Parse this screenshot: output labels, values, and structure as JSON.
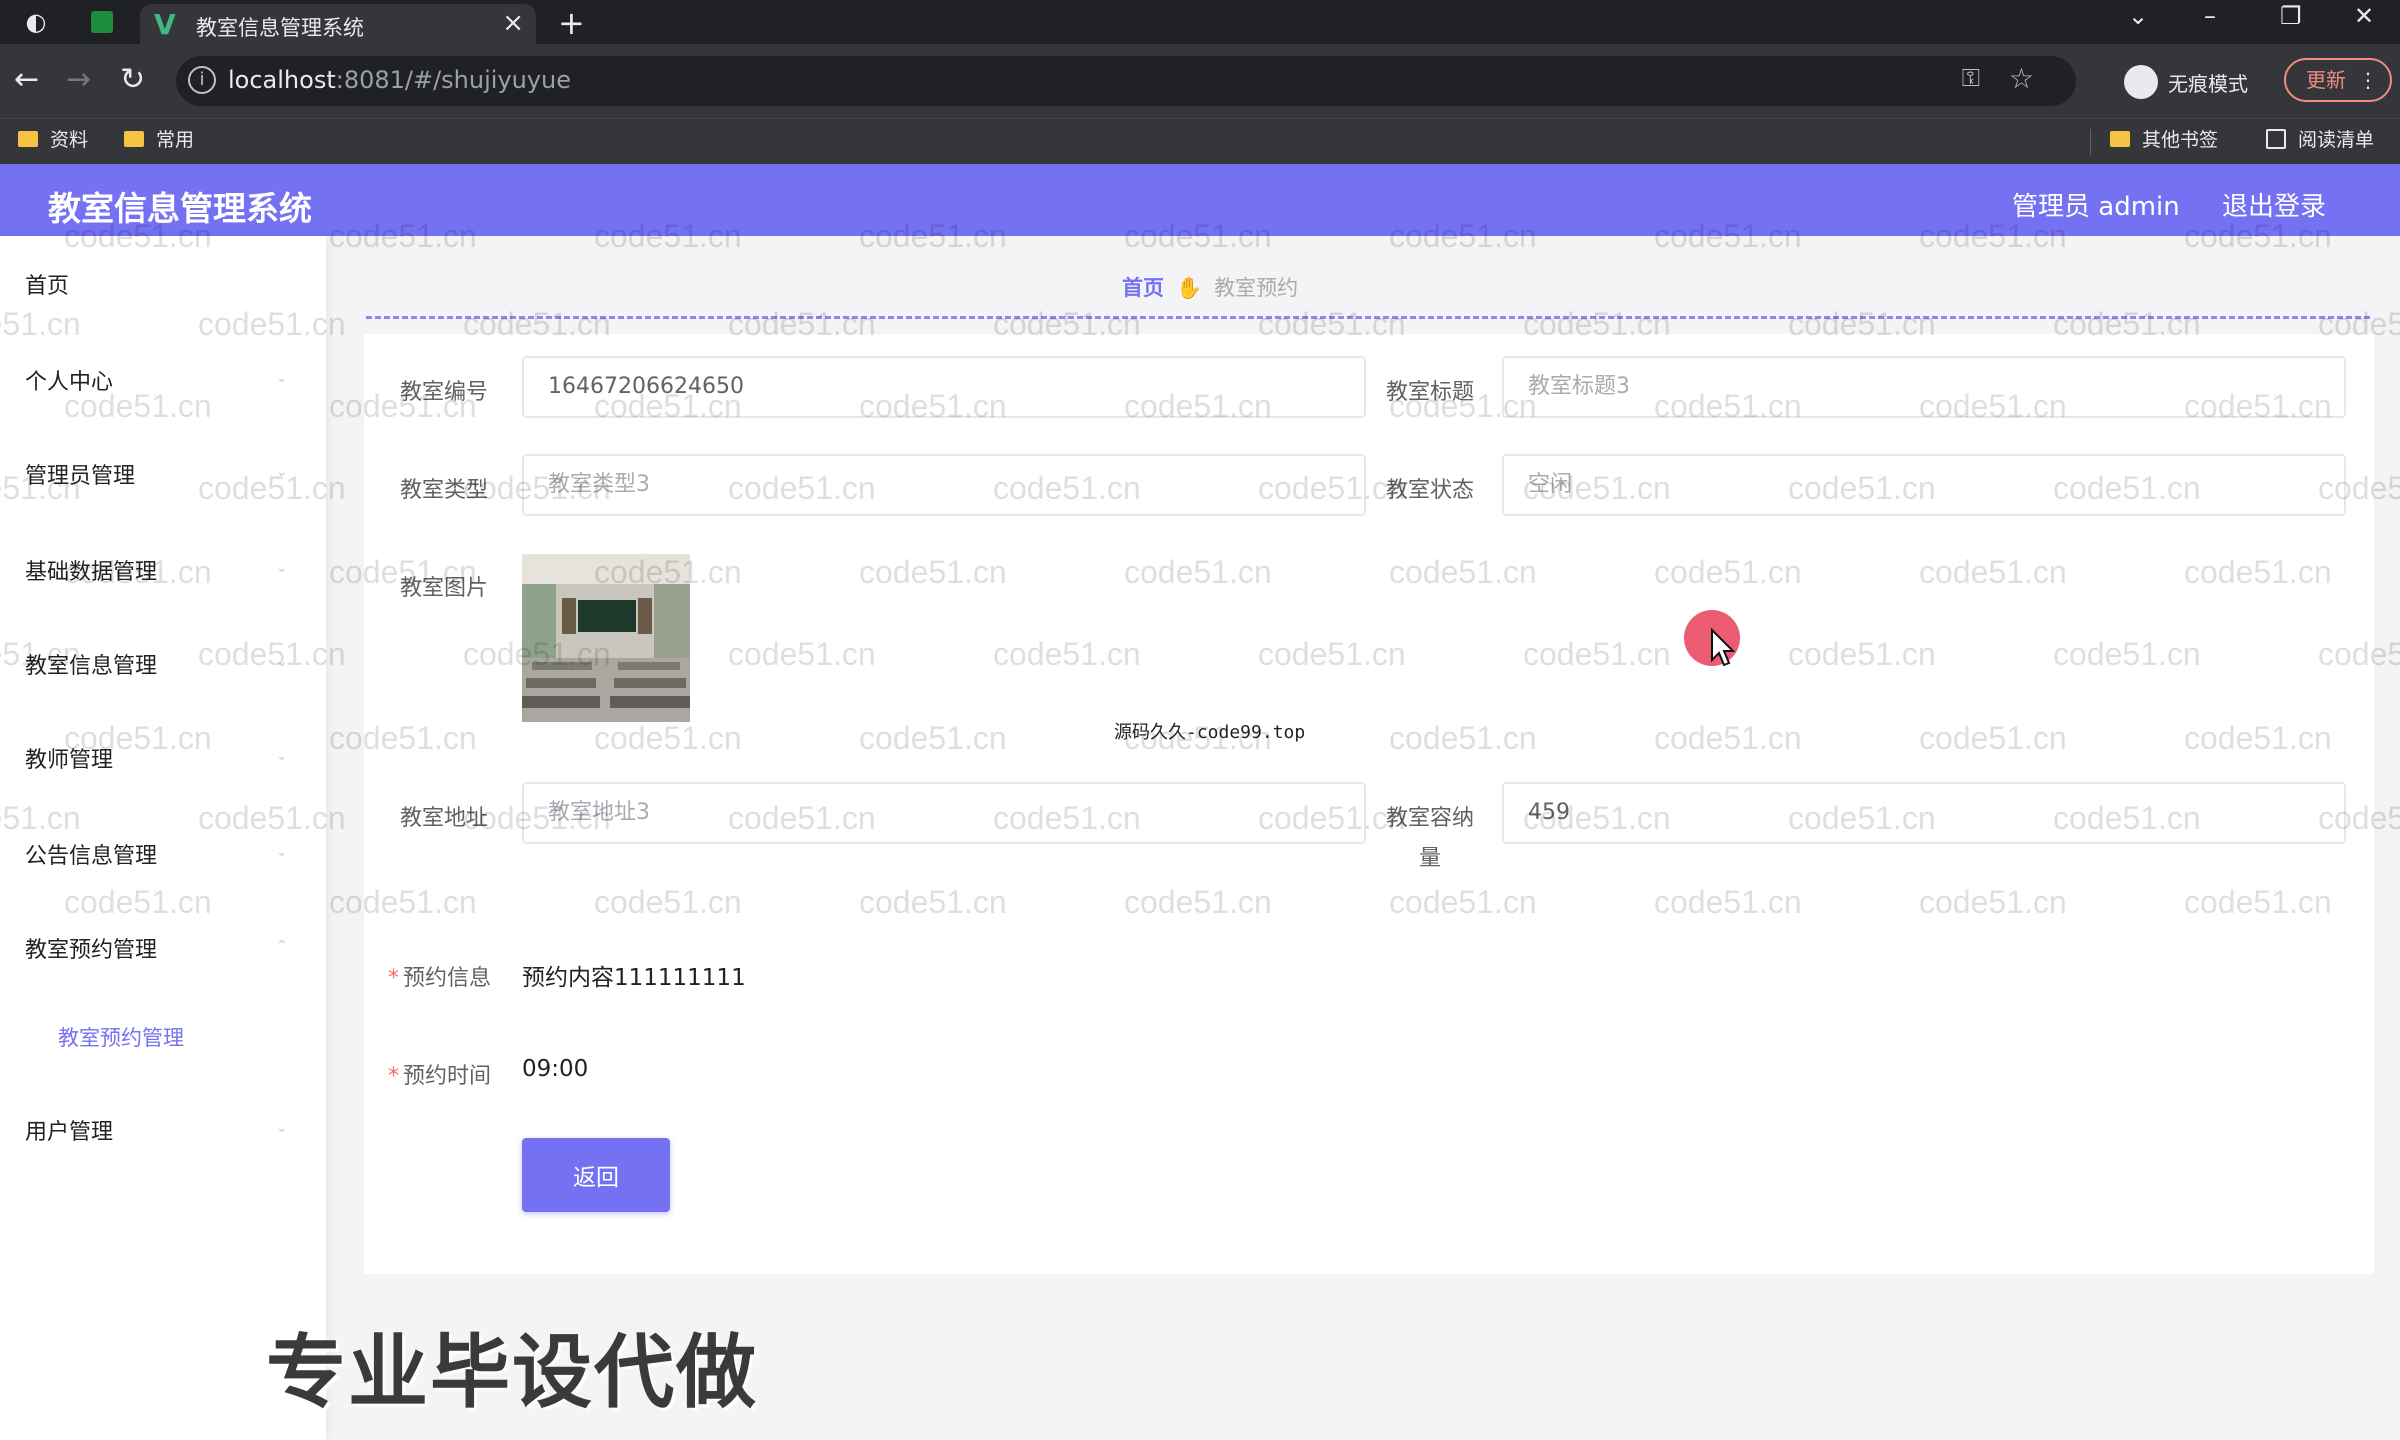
{
  "browser": {
    "tab_title": "教室信息管理系统",
    "url_host": "localhost",
    "url_path": ":8081/#/shujiyuyue",
    "incognito_label": "无痕模式",
    "update_label": "更新",
    "bookmarks": [
      "资料",
      "常用"
    ],
    "other_bookmarks": "其他书签",
    "reading_list": "阅读清单"
  },
  "header": {
    "title": "教室信息管理系统",
    "user": "管理员 admin",
    "logout": "退出登录"
  },
  "sidebar": {
    "items": [
      "首页",
      "个人中心",
      "管理员管理",
      "基础数据管理",
      "教室信息管理",
      "教师管理",
      "公告信息管理",
      "教室预约管理",
      "用户管理"
    ],
    "sub_item": "教室预约管理"
  },
  "breadcrumb": {
    "home": "首页",
    "current": "教室预约"
  },
  "form": {
    "room_no_label": "教室编号",
    "room_no": "16467206624650",
    "room_title_label": "教室标题",
    "room_title": "教室标题3",
    "room_type_label": "教室类型",
    "room_type": "教室类型3",
    "room_status_label": "教室状态",
    "room_status": "空闲",
    "room_image_label": "教室图片",
    "room_address_label": "教室地址",
    "room_address": "教室地址3",
    "capacity_label_line1": "教室容纳",
    "capacity_label_line2": "量",
    "capacity": "459",
    "booking_info_label": "预约信息",
    "booking_info": "预约内容111111111",
    "booking_time_label": "预约时间",
    "booking_time": "09:00",
    "back_button": "返回"
  },
  "overlay": {
    "watermark": "code51.cn",
    "center_note": "源码久久-code99.top",
    "promo": "专业毕设代做"
  },
  "colors": {
    "accent": "#7471f3",
    "required": "#f56c6c"
  }
}
